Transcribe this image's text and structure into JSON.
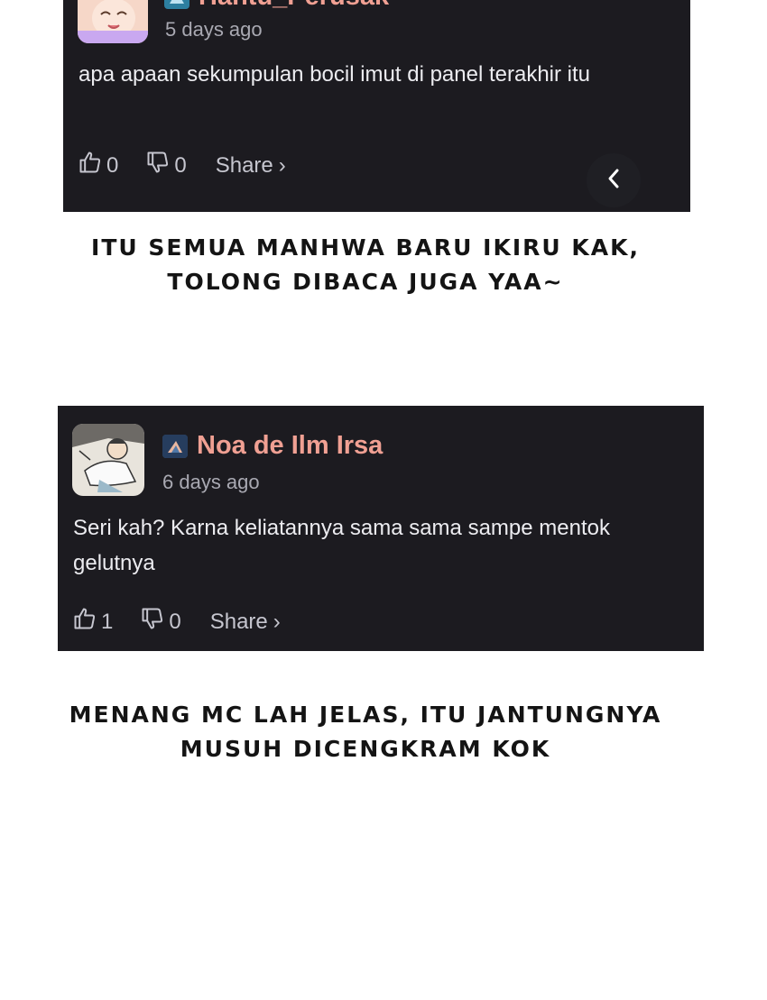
{
  "comments": [
    {
      "username": "Hantu_Perusak",
      "timestamp": "5 days ago",
      "text": "apa apaan sekumpulan bocil imut di panel terakhir itu",
      "likes": "0",
      "dislikes": "0",
      "share_label": "Share",
      "share_chevron": "›",
      "badge_color": "#2d7fa0"
    },
    {
      "username": "Noa de Ilm Irsa",
      "timestamp": "6 days ago",
      "text": "Seri kah? Karna keliatannya sama sama sampe mentok gelutnya",
      "likes": "1",
      "dislikes": "0",
      "share_label": "Share",
      "share_chevron": "›",
      "badge_color": "#3b5c86"
    }
  ],
  "captions": [
    [
      "ITU SEMUA MANHWA BARU IKIRU KAK,",
      "TOLONG DIBACA JUGA YAA~"
    ],
    [
      "MENANG MC LAH JELAS, ITU JANTUNGNYA",
      "MUSUH DICENGKRAM KOK"
    ]
  ],
  "colors": {
    "card_background": "#1c1b20",
    "username": "#f0a093",
    "timestamp": "#a9a9b2",
    "page_background": "#ffffff"
  },
  "icons": [
    "thumbs-up-icon",
    "thumbs-down-icon",
    "chevron-left-icon",
    "user-badge-icon"
  ]
}
